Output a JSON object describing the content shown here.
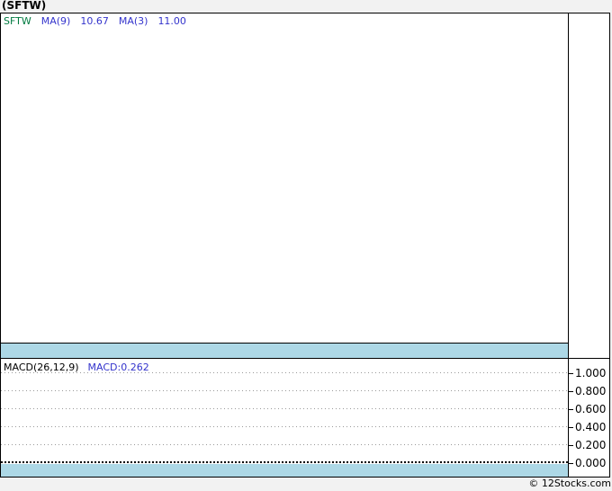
{
  "page": {
    "title": "(SFTW)",
    "copyright": "© 12Stocks.com"
  },
  "colors": {
    "page_background": "#f2f2f2",
    "panel_background": "#ffffff",
    "border": "#000000",
    "band_blue": "#add8e6",
    "gridline_gray": "#999999",
    "ticker_green": "#007a40",
    "indicator_blue": "#3333cc"
  },
  "main_panel": {
    "legend": {
      "ticker": "SFTW",
      "ma9_label": "MA(9)",
      "ma9_value": "10.67",
      "ma3_label": "MA(3)",
      "ma3_value": "11.00"
    }
  },
  "macd_panel": {
    "legend": {
      "label": "MACD(26,12,9)",
      "value": "MACD:0.262"
    },
    "y_axis": {
      "ticks": [
        "1.000",
        "0.800",
        "0.600",
        "0.400",
        "0.200",
        "0.000"
      ]
    }
  },
  "chart_data": [
    {
      "type": "line",
      "title": "(SFTW)",
      "panel": "price",
      "legend": [
        "SFTW",
        "MA(9)",
        "MA(3)"
      ],
      "series": [
        {
          "name": "MA(9)",
          "last_value": 10.67,
          "visible_points": []
        },
        {
          "name": "MA(3)",
          "last_value": 11.0,
          "visible_points": []
        }
      ],
      "grid": "off",
      "note": "plot area is empty - no price curve rendered in screenshot"
    },
    {
      "type": "line",
      "title": "MACD(26,12,9)",
      "panel": "indicator",
      "legend": [
        "MACD:0.262"
      ],
      "series": [
        {
          "name": "MACD",
          "last_value": 0.262,
          "visible_points": []
        }
      ],
      "ylim": [
        0.0,
        1.0
      ],
      "yticks": [
        1.0,
        0.8,
        0.6,
        0.4,
        0.2,
        0.0
      ],
      "grid": "dotted horizontal gridlines, solid-dotted zero line",
      "legend_position": "top-left",
      "y_axis_position": "right"
    }
  ]
}
